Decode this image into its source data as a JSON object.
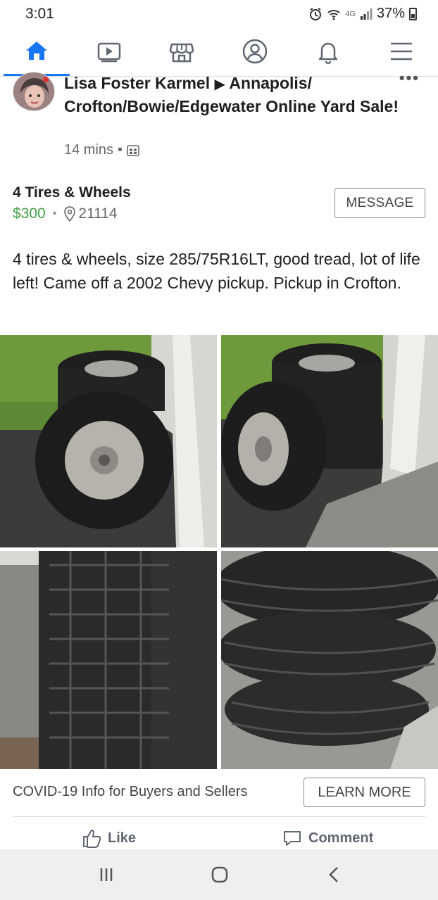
{
  "status_bar": {
    "time": "3:01",
    "network": "4G",
    "battery": "37%"
  },
  "nav": {
    "items": [
      {
        "name": "home",
        "icon": "home-icon",
        "active": true
      },
      {
        "name": "watch",
        "icon": "video-icon",
        "active": false
      },
      {
        "name": "marketplace",
        "icon": "shop-icon",
        "active": false
      },
      {
        "name": "profile",
        "icon": "profile-icon",
        "active": false
      },
      {
        "name": "notifications",
        "icon": "bell-icon",
        "active": false
      },
      {
        "name": "menu",
        "icon": "menu-icon",
        "active": false
      }
    ],
    "active_color": "#1877f2"
  },
  "post": {
    "author": "Lisa Foster Karmel",
    "arrow": "▶",
    "group": "Annapolis/ Crofton/Bowie/Edgewater Online Yard Sale!",
    "time_ago": "14 mins",
    "meta_sep": "•"
  },
  "listing": {
    "title": "4 Tires & Wheels",
    "price": "$300",
    "sep": "•",
    "zip": "21114",
    "message_label": "MESSAGE",
    "price_color": "#42a047",
    "description": "4 tires & wheels, size 285/75R16LT, good tread, lot of life left!  Came off a 2002 Chevy pickup. Pickup in Crofton."
  },
  "footer": {
    "covid_text": "COVID-19 Info for Buyers and Sellers",
    "learn_more_label": "LEARN MORE",
    "like_label": "Like",
    "comment_label": "Comment"
  }
}
